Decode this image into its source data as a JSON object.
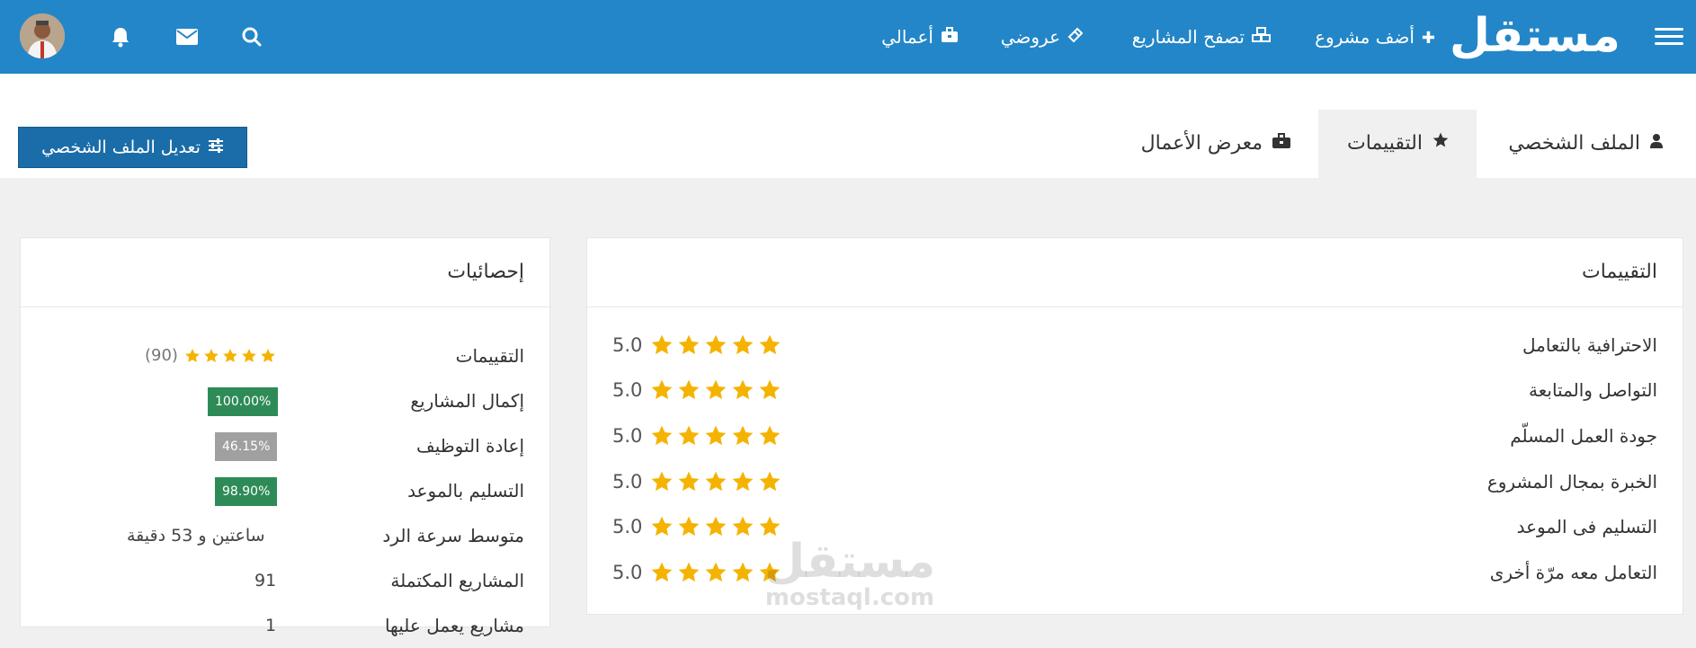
{
  "header": {
    "logo": "مستقل",
    "nav": [
      {
        "label": "أضف مشروع",
        "icon": "plus-icon"
      },
      {
        "label": "تصفح المشاريع",
        "icon": "cubes-icon"
      },
      {
        "label": "عروضي",
        "icon": "ticket-icon"
      },
      {
        "label": "أعمالي",
        "icon": "briefcase-icon"
      }
    ],
    "icons": [
      "search-icon",
      "mail-icon",
      "bell-icon",
      "avatar"
    ]
  },
  "tabs": [
    {
      "label": "الملف الشخصي",
      "icon": "user-icon"
    },
    {
      "label": "التقييمات",
      "icon": "star-icon",
      "active": true
    },
    {
      "label": "معرض الأعمال",
      "icon": "briefcase-icon"
    }
  ],
  "edit_button": {
    "label": "تعديل الملف الشخصي",
    "icon": "sliders-icon"
  },
  "reviews": {
    "title": "التقييمات",
    "items": [
      {
        "label": "الاحترافية بالتعامل",
        "score": "5.0",
        "stars": 5
      },
      {
        "label": "التواصل والمتابعة",
        "score": "5.0",
        "stars": 5
      },
      {
        "label": "جودة العمل المسلّم",
        "score": "5.0",
        "stars": 5
      },
      {
        "label": "الخبرة بمجال المشروع",
        "score": "5.0",
        "stars": 5
      },
      {
        "label": "التسليم فى الموعد",
        "score": "5.0",
        "stars": 5
      },
      {
        "label": "التعامل معه مرّة أخرى",
        "score": "5.0",
        "stars": 5
      }
    ]
  },
  "stats": {
    "title": "إحصائيات",
    "ratings": {
      "label": "التقييمات",
      "count": "(90)",
      "stars": 5
    },
    "completion": {
      "label": "إكمال المشاريع",
      "value": "100.00%"
    },
    "rehire": {
      "label": "إعادة التوظيف",
      "value": "46.15%"
    },
    "on_time": {
      "label": "التسليم بالموعد",
      "value": "98.90%"
    },
    "response": {
      "label": "متوسط سرعة الرد",
      "value": "ساعتين و 53 دقيقة"
    },
    "completed": {
      "label": "المشاريع المكتملة",
      "value": "91"
    },
    "in_progress": {
      "label": "مشاريع يعمل عليها",
      "value": "1"
    }
  },
  "watermark": {
    "ar": "مستقل",
    "en": "mostaql.com"
  },
  "colors": {
    "header": "#2386c8",
    "button": "#1b6da9",
    "star": "#f5b301",
    "badge_green": "#2e8b57",
    "badge_grey": "#a0a0a0"
  }
}
